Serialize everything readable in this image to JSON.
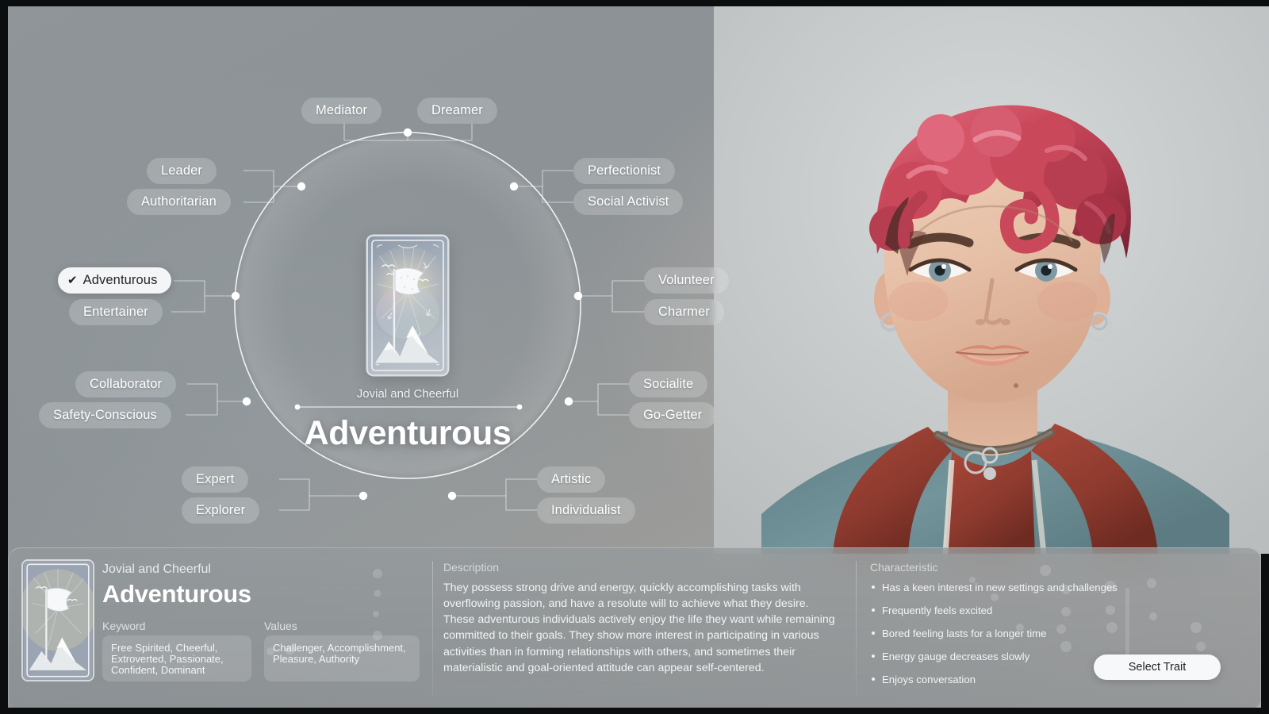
{
  "theme": {
    "accent_white": "#f4f5f6",
    "pill_bg": "rgba(236,238,240,0.24)",
    "text_primary": "#ffffff",
    "text_muted": "#d5d9db",
    "panel_bg": "rgba(142,149,152,0.66)",
    "selected_text": "#22262b"
  },
  "wheel": {
    "center": {
      "subtitle": "Jovial and Cheerful",
      "title": "Adventurous",
      "card_icon": "flag-mountain-tarot-card"
    },
    "nodes": [
      {
        "angle": "top",
        "labels": [
          "Mediator",
          "Dreamer"
        ]
      },
      {
        "angle": "upper-left",
        "labels": [
          "Leader",
          "Authoritarian"
        ]
      },
      {
        "angle": "upper-right",
        "labels": [
          "Perfectionist",
          "Social Activist"
        ]
      },
      {
        "angle": "left",
        "labels": [
          "Adventurous",
          "Entertainer"
        ]
      },
      {
        "angle": "right",
        "labels": [
          "Volunteer",
          "Charmer"
        ]
      },
      {
        "angle": "lower-left",
        "labels": [
          "Collaborator",
          "Safety-Conscious"
        ]
      },
      {
        "angle": "lower-right",
        "labels": [
          "Socialite",
          "Go-Getter"
        ]
      },
      {
        "angle": "bottom-left",
        "labels": [
          "Expert",
          "Explorer"
        ]
      },
      {
        "angle": "bottom-right",
        "labels": [
          "Artistic",
          "Individualist"
        ]
      }
    ],
    "selected": "Adventurous",
    "check_glyph": "✔"
  },
  "panel": {
    "subtitle": "Jovial and Cheerful",
    "title": "Adventurous",
    "card_icon": "flag-mountain-tarot-card",
    "keyword": {
      "label": "Keyword",
      "value": "Free Spirited, Cheerful, Extroverted, Passionate, Confident, Dominant"
    },
    "values": {
      "label": "Values",
      "value": "Challenger, Accomplishment, Pleasure, Authority"
    },
    "description": {
      "label": "Description",
      "text": "They possess strong drive and energy, quickly accomplishing tasks with overflowing passion, and have a resolute will to achieve what they desire. These adventurous individuals actively enjoy the life they want while remaining committed to their goals. They show more interest in participating in various activities than in forming relationships with others, and sometimes their materialistic and goal-oriented attitude can appear self-centered."
    },
    "characteristic": {
      "label": "Characteristic",
      "items": [
        "Has a keen interest in new settings and challenges",
        "Frequently feels excited",
        "Bored feeling lasts for a longer time",
        "Energy gauge decreases slowly",
        "Enjoys conversation"
      ]
    },
    "select_button": "Select Trait"
  },
  "character": {
    "hair_color": "#c9485a",
    "hoodie_color": "#6f8c90",
    "hoodie_lining": "#9e4236",
    "skin_color": "#e8c3ad"
  }
}
